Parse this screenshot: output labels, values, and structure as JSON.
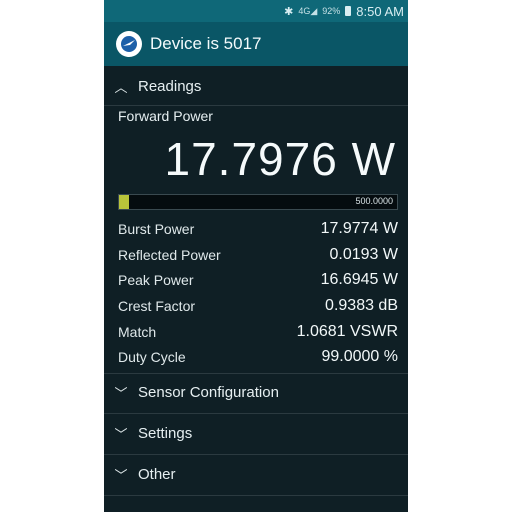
{
  "status_bar": {
    "icons": [
      "bluetooth-icon",
      "signal-icon",
      "battery-icon"
    ],
    "signal_text": "4G",
    "battery_percent": "92%",
    "time": "8:50 AM"
  },
  "app_bar": {
    "title": "Device is 5017",
    "logo_icon": "power-meter-logo"
  },
  "readings_section": {
    "header": "Readings",
    "forward_power_label": "Forward Power",
    "forward_power_value": "17.7976 W",
    "bar": {
      "max_label": "500.0000",
      "fill_fraction": 0.036
    },
    "rows": [
      {
        "label": "Burst Power",
        "value": "17.9774 W"
      },
      {
        "label": "Reflected Power",
        "value": "0.0193 W"
      },
      {
        "label": "Peak Power",
        "value": "16.6945 W"
      },
      {
        "label": "Crest Factor",
        "value": "0.9383 dB"
      },
      {
        "label": "Match",
        "value": "1.0681 VSWR"
      },
      {
        "label": "Duty Cycle",
        "value": "99.0000 %"
      }
    ]
  },
  "collapsed_sections": [
    {
      "label": "Sensor Configuration"
    },
    {
      "label": "Settings"
    },
    {
      "label": "Other"
    }
  ],
  "colors": {
    "status_bar": "#0f6878",
    "app_bar": "#0a5666",
    "background": "#0f1f25",
    "bar_fill": "#b9c43a"
  }
}
